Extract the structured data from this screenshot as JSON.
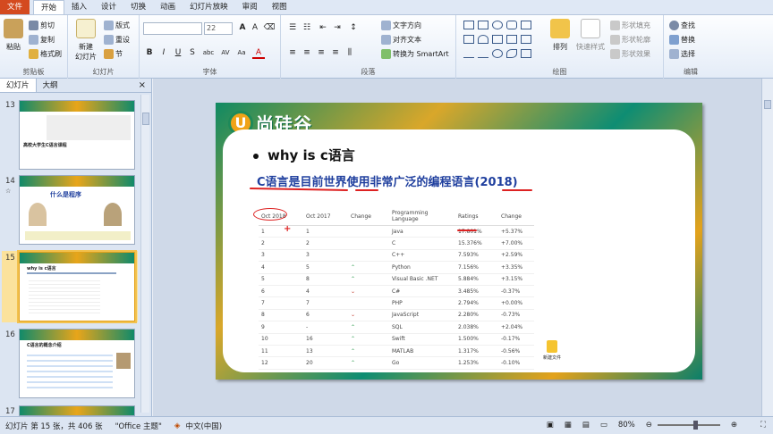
{
  "tabs": [
    "文件",
    "开始",
    "插入",
    "设计",
    "切换",
    "动画",
    "幻灯片放映",
    "审阅",
    "视图"
  ],
  "active_tab": "开始",
  "ribbon": {
    "clipboard": {
      "label": "剪贴板",
      "paste": "粘贴",
      "cut": "剪切",
      "copy": "复制",
      "format_painter": "格式刷"
    },
    "slides": {
      "label": "幻灯片",
      "new_slide": "新建\n幻灯片",
      "layout": "版式",
      "reset": "重设",
      "section": "节"
    },
    "font": {
      "label": "字体",
      "font_name": "",
      "font_size": "22",
      "bold": "B",
      "italic": "I",
      "underline": "U",
      "strike": "S",
      "shadow": "abc",
      "spacing": "AV",
      "case": "Aa",
      "color": "A"
    },
    "paragraph": {
      "label": "段落",
      "text_direction": "文字方向",
      "align_text": "对齐文本",
      "smartart": "转换为 SmartArt"
    },
    "drawing": {
      "label": "绘图",
      "arrange": "排列",
      "quick_styles": "快速样式",
      "shape_fill": "形状填充",
      "shape_outline": "形状轮廓",
      "shape_effects": "形状效果"
    },
    "editing": {
      "label": "编辑",
      "find": "查找",
      "replace": "替换",
      "select": "选择"
    }
  },
  "panel": {
    "tabs": [
      "幻灯片",
      "大纲"
    ],
    "close": "×",
    "slides": [
      {
        "num": "13",
        "text": "高校大学生C语言课程"
      },
      {
        "num": "14",
        "text": "什么是程序"
      },
      {
        "num": "15",
        "text": "why is c语言"
      },
      {
        "num": "16",
        "text": "C语言的概念介绍"
      },
      {
        "num": "17",
        "text": ""
      }
    ],
    "side_marks": [
      "☆",
      "☆",
      "☆"
    ]
  },
  "slide": {
    "logo_text": "尚硅谷",
    "title": "why is c语言",
    "subtitle": "C语言是目前世界使用非常广泛的编程语言(2018)",
    "table": {
      "headers": [
        "Oct 2018",
        "Oct 2017",
        "Change",
        "Programming Language",
        "Ratings",
        "Change"
      ],
      "rows": [
        [
          "1",
          "1",
          "",
          "Java",
          "17.801%",
          "+5.37%"
        ],
        [
          "2",
          "2",
          "",
          "C",
          "15.376%",
          "+7.00%"
        ],
        [
          "3",
          "3",
          "",
          "C++",
          "7.593%",
          "+2.59%"
        ],
        [
          "4",
          "5",
          "up",
          "Python",
          "7.156%",
          "+3.35%"
        ],
        [
          "5",
          "8",
          "up",
          "Visual Basic .NET",
          "5.884%",
          "+3.15%"
        ],
        [
          "6",
          "4",
          "down",
          "C#",
          "3.485%",
          "-0.37%"
        ],
        [
          "7",
          "7",
          "",
          "PHP",
          "2.794%",
          "+0.00%"
        ],
        [
          "8",
          "6",
          "down",
          "JavaScript",
          "2.280%",
          "-0.73%"
        ],
        [
          "9",
          "-",
          "up",
          "SQL",
          "2.038%",
          "+2.04%"
        ],
        [
          "10",
          "16",
          "up",
          "Swift",
          "1.500%",
          "-0.17%"
        ],
        [
          "11",
          "13",
          "up",
          "MATLAB",
          "1.317%",
          "-0.56%"
        ],
        [
          "12",
          "20",
          "up",
          "Go",
          "1.253%",
          "-0.10%"
        ]
      ]
    },
    "doc_label": "新建文件"
  },
  "status": {
    "slide_info": "幻灯片 第 15 张，共 406 张",
    "theme": "\"Office 主题\"",
    "language": "中文(中国)",
    "zoom": "80%"
  },
  "colors": {
    "accent": "#1f3f9e",
    "file_tab": "#d44a1f",
    "annotation": "#dd2222"
  }
}
